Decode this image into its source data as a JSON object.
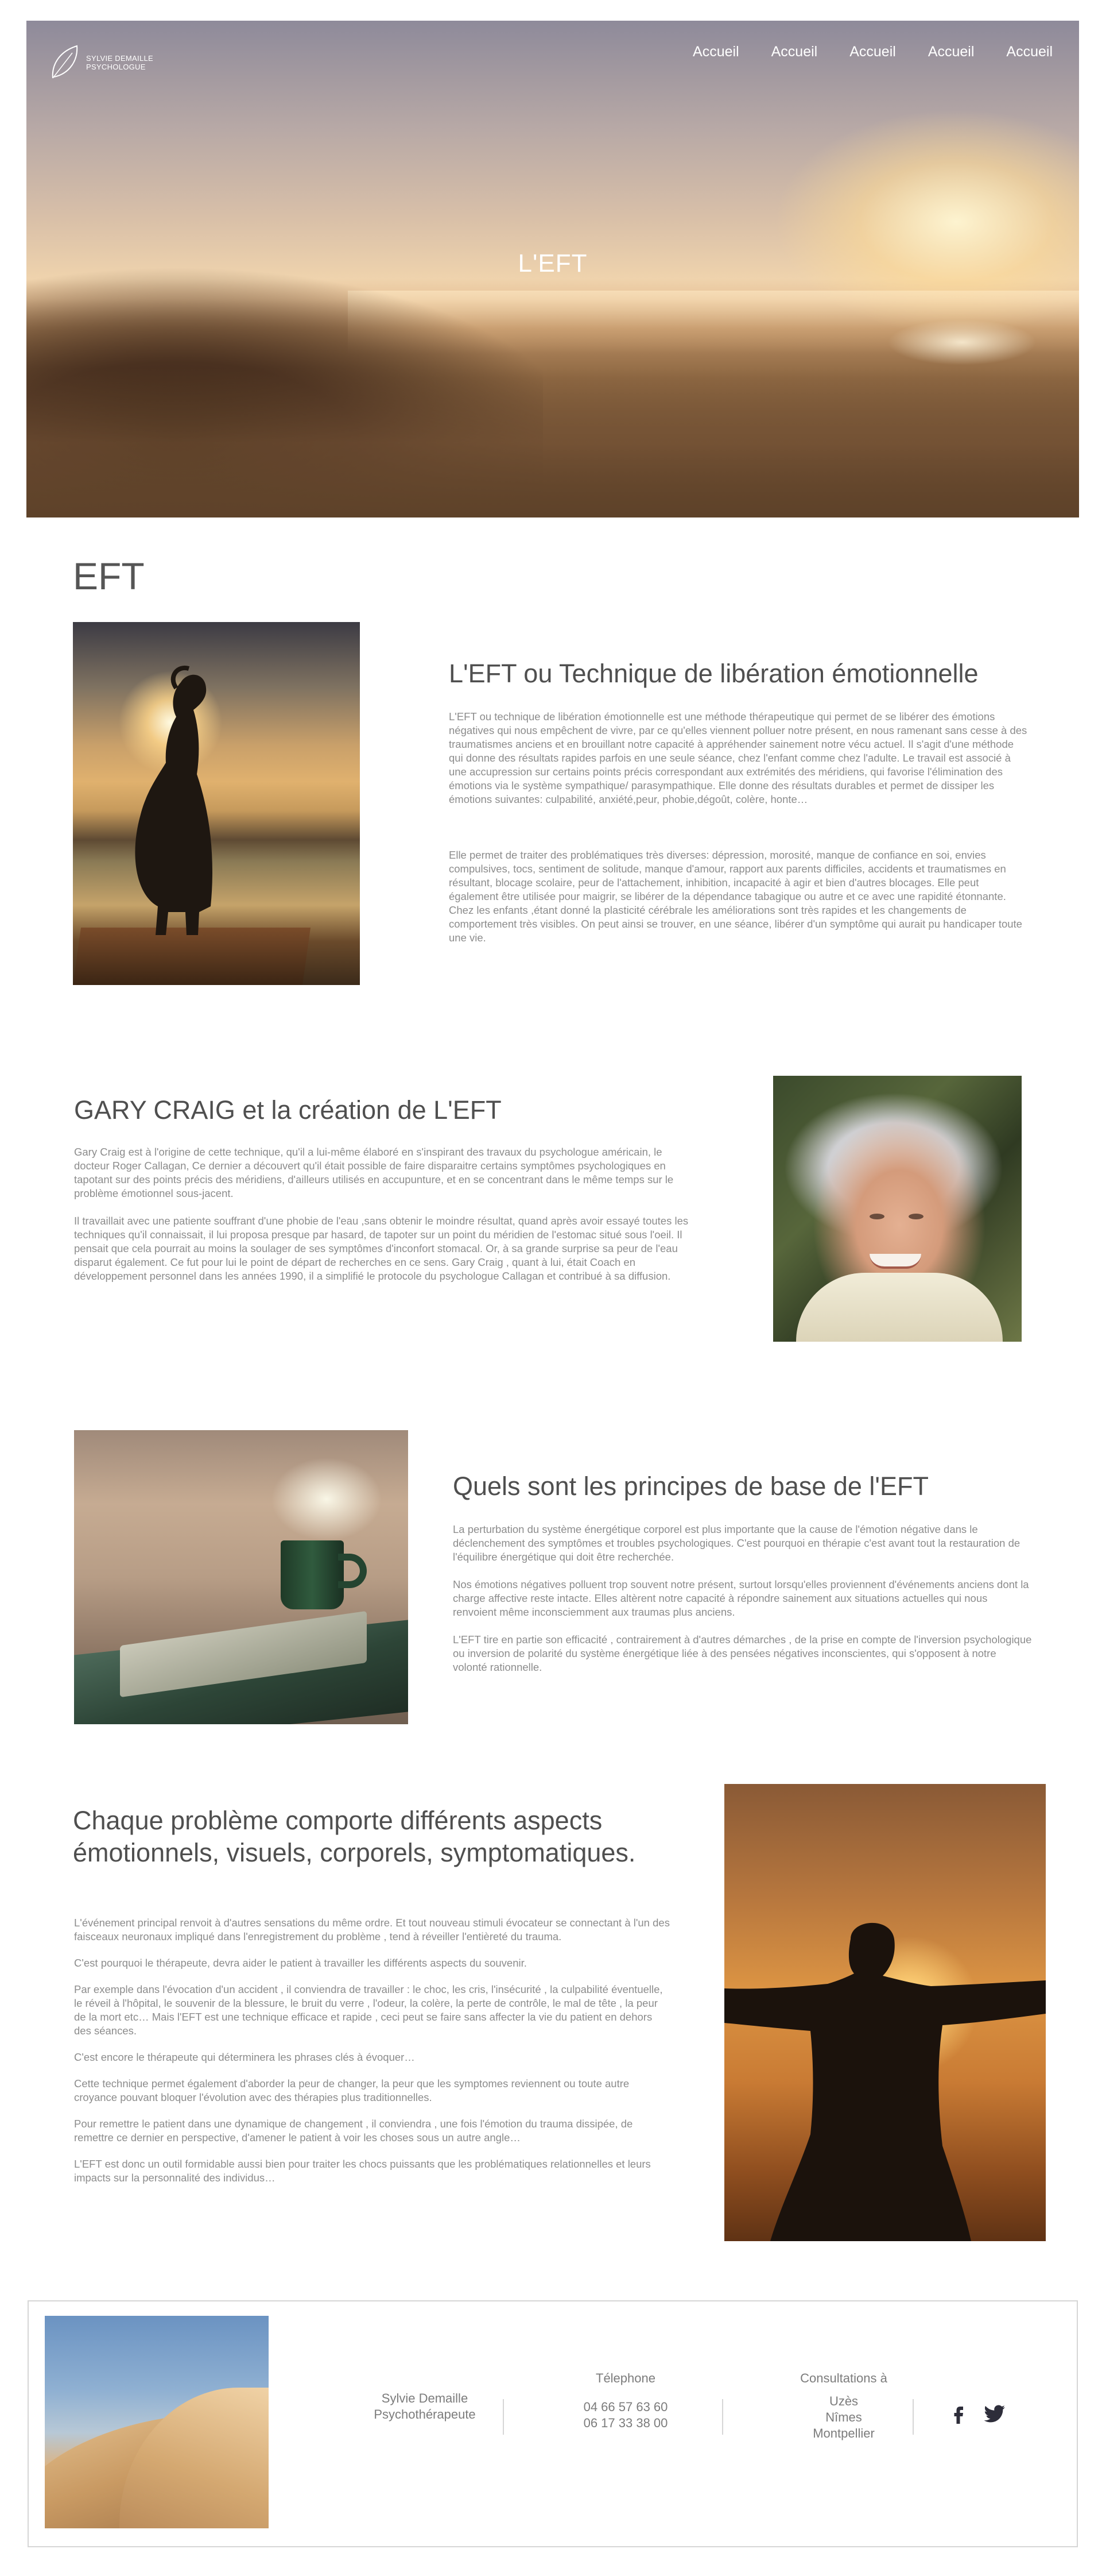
{
  "header": {
    "logo": {
      "line1": "SYLVIE DEMAILLE",
      "line2": "PSYCHOLOGUE"
    },
    "nav": [
      "Accueil",
      "Accueil",
      "Accueil",
      "Accueil",
      "Accueil"
    ],
    "hero_title": "L'EFT"
  },
  "page_title": "EFT",
  "section1": {
    "title": "L'EFT ou Technique de libération émotionnelle",
    "p1": "L'EFT ou technique de libération émotionnelle est une méthode thérapeutique qui permet de se libérer des émotions négatives qui nous empêchent de vivre, par ce qu'elles viennent polluer notre présent, en nous ramenant sans cesse à des traumatismes anciens et en brouillant notre capacité à appréhender sainement notre vécu actuel. Il s'agit d'une méthode qui donne des résultats rapides parfois en une seule séance, chez l'enfant comme chez l'adulte. Le travail est associé à une accupression sur certains points précis correspondant aux extrémités des méridiens, qui favorise l'élimination des émotions via le système sympathique/ parasympathique. Elle donne des résultats durables et permet de dissiper les émotions suivantes: culpabilité, anxiété,peur, phobie,dégoût, colère, honte…",
    "p2": "Elle permet de traiter des problématiques très diverses: dépression, morosité, manque de confiance en soi, envies compulsives, tocs, sentiment de solitude, manque d'amour, rapport aux parents difficiles, accidents et traumatismes en résultant, blocage scolaire, peur de l'attachement, inhibition, incapacité à agir et bien d'autres blocages. Elle peut également être utilisée pour maigrir, se libérer de la dépendance tabagique ou autre et ce avec une rapidité étonnante. Chez les enfants ,étant donné la plasticité cérébrale les améliorations sont très rapides et les changements de comportement très visibles. On peut ainsi se trouver, en une séance, libérer d'un symptôme qui aurait pu handicaper toute une vie."
  },
  "section2": {
    "title": "GARY CRAIG et la création de L'EFT",
    "p1": "Gary Craig est à l'origine de cette technique, qu'il a lui-même élaboré en s'inspirant des travaux du psychologue américain, le docteur Roger Callagan, Ce dernier a découvert qu'il était possible de faire disparaitre certains symptômes psychologiques en tapotant sur des points précis des méridiens, d'ailleurs utilisés en accupunture, et en se concentrant dans le même temps sur le problème émotionnel sous-jacent.",
    "p2": "Il travaillait avec une patiente souffrant d'une phobie de l'eau ,sans obtenir le moindre résultat, quand après avoir essayé toutes les techniques qu'il connaissait, il lui proposa presque par hasard, de tapoter sur un point du méridien de l'estomac situé sous l'oeil. Il pensait que cela pourrait au moins la soulager de ses symptômes d'inconfort stomacal. Or, à sa grande surprise sa peur de l'eau disparut également. Ce fut pour lui le point de départ de recherches en ce sens. Gary Craig , quant à lui, était Coach en développement personnel dans les années 1990, il a simplifié le protocole du psychologue Callagan et contribué à sa diffusion."
  },
  "section3": {
    "title": "Quels sont les principes de base de l'EFT",
    "p1": "La perturbation du système énergétique corporel est plus importante que la cause de l'émotion négative dans le déclenchement des symptômes et troubles psychologiques. C'est pourquoi en thérapie c'est avant tout la restauration de l'équilibre énergétique qui doit être recherchée.",
    "p2": "Nos émotions négatives polluent trop souvent notre présent, surtout lorsqu'elles proviennent d'événements anciens dont la charge affective reste intacte. Elles altèrent notre capacité à répondre sainement aux situations actuelles qui nous renvoient même inconsciemment aux traumas plus anciens.",
    "p3": "L'EFT tire en partie son efficacité , contrairement à d'autres démarches , de la prise en compte de l'inversion psychologique ou inversion de polarité du système énergétique liée à des pensées négatives inconscientes, qui s'opposent à notre volonté rationnelle."
  },
  "section4": {
    "title": "Chaque problème comporte différents aspects émotionnels, visuels, corporels, symptomatiques.",
    "paragraphs": [
      "L'événement principal renvoit à d'autres sensations du même ordre. Et tout nouveau stimuli évocateur se connectant à l'un des faisceaux neuronaux impliqué dans l'enregistrement du problème , tend à réveiller l'entièreté du trauma.",
      "C'est pourquoi le thérapeute, devra aider le patient à travailler les différents aspects du souvenir.",
      "Par exemple dans l'évocation d'un accident , il conviendra de travailler : le choc, les cris, l'insécurité , la culpabilité éventuelle, le réveil à l'hôpital, le souvenir de la blessure, le bruit du verre , l'odeur, la colère, la perte de contrôle, le mal de tête , la peur de la mort etc… Mais l'EFT est une technique efficace et rapide , ceci peut se faire sans affecter la vie du patient en dehors des séances.",
      "C'est encore le thérapeute qui déterminera les phrases clés à évoquer…",
      "Cette technique permet également d'aborder la peur de changer, la peur que les symptomes reviennent ou toute autre croyance pouvant bloquer l'évolution avec des thérapies plus traditionnelles.",
      "Pour remettre le patient dans une dynamique de changement , il conviendra , une fois l'émotion du trauma dissipée, de remettre ce dernier en perspective, d'amener le patient à voir les choses sous un autre angle…",
      "L'EFT est donc un outil formidable aussi bien pour traiter les chocs puissants que les problématiques relationnelles et leurs impacts sur la personnalité des individus…"
    ]
  },
  "footer": {
    "name": "Sylvie Demaille",
    "role": "Psychothérapeute",
    "phone_label": "Télephone",
    "phone1": "04 66 57 63 60",
    "phone2": "06 17 33 38 00",
    "consult_label": "Consultations à",
    "city1": "Uzès",
    "city2": "Nîmes",
    "city3": "Montpellier",
    "social": [
      "facebook-icon",
      "twitter-icon"
    ]
  }
}
